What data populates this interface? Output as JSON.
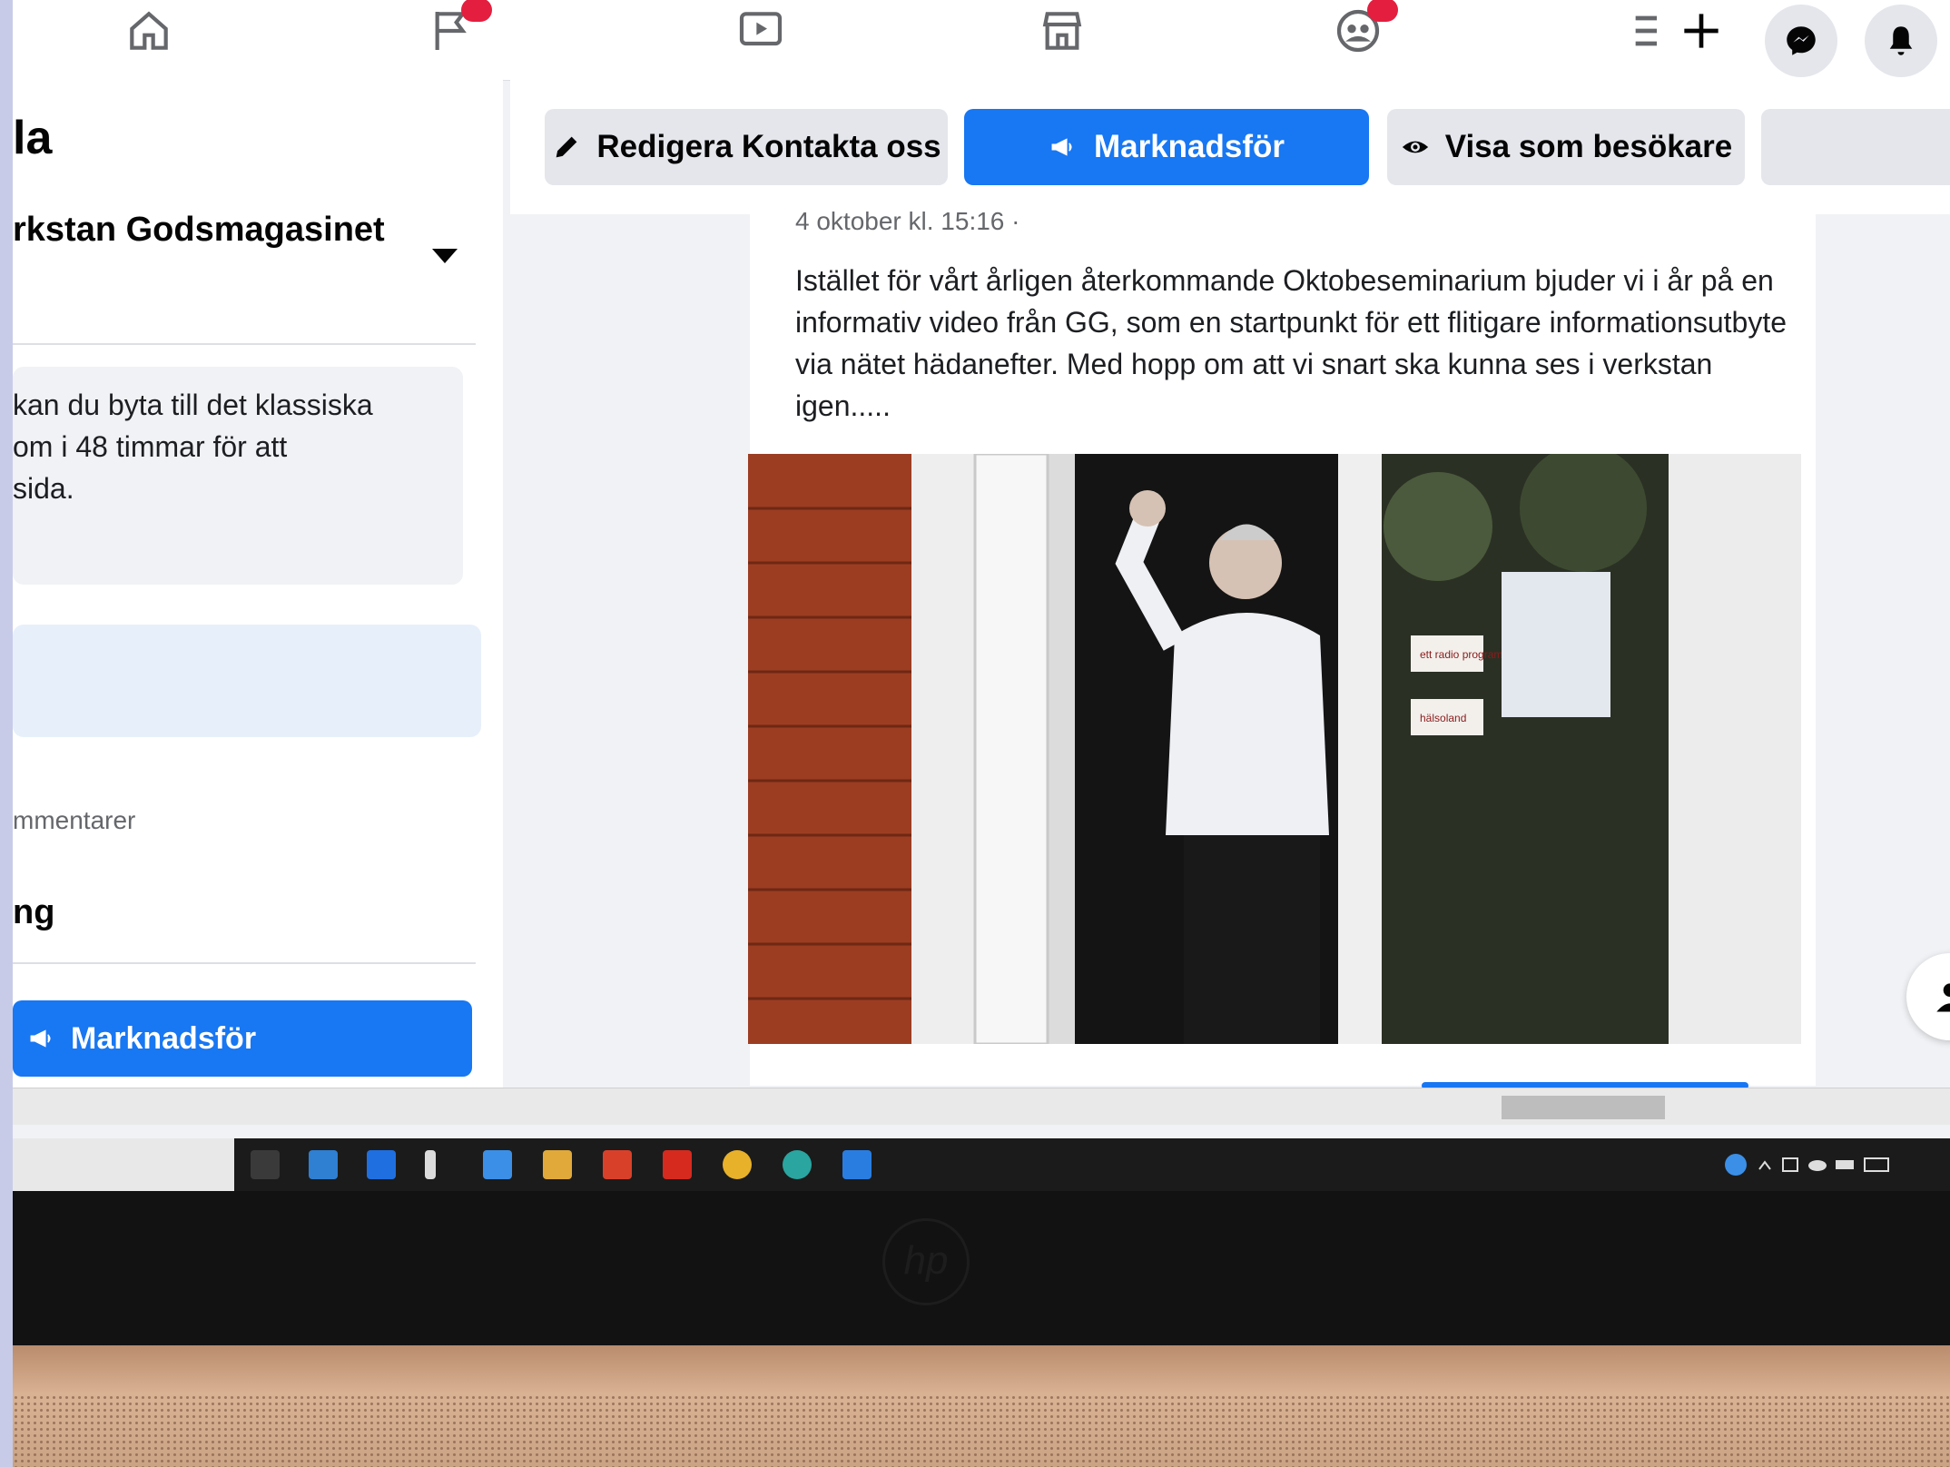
{
  "left_panel": {
    "page_name": "la",
    "page_subtitle": "rkstan Godsmagasinet",
    "info_lines": [
      "kan du byta till det klassiska",
      "om i 48 timmar för att",
      "sida."
    ],
    "comments_label": "mmentarer",
    "section_label": "ng",
    "promote_label": "Marknadsför"
  },
  "action_bar": {
    "edit_label": "Redigera Kontakta oss",
    "promote_label": "Marknadsför",
    "view_as_label": "Visa som besökare"
  },
  "post": {
    "meta": "4 oktober kl. 15:16 ·",
    "text": "Istället för vårt årligen återkommande Oktobeseminarium bjuder vi i år på en informativ video från GG, som en startpunkt för ett flitigare informationsutbyte via nätet hädanefter. Med hopp om att vi snart ska kunna ses i verkstan igen.....",
    "photo_signs": [
      "ett radio program",
      "hälsoland"
    ]
  },
  "icons": [
    "home-icon",
    "flag-icon",
    "video-icon",
    "store-icon",
    "groups-icon",
    "menu-icon",
    "plus-icon",
    "messenger-icon",
    "bell-icon",
    "pencil-icon",
    "megaphone-icon",
    "eye-icon",
    "person-icon"
  ],
  "colors": {
    "brand_blue": "#1877f2",
    "badge_red": "#e41e3f"
  }
}
